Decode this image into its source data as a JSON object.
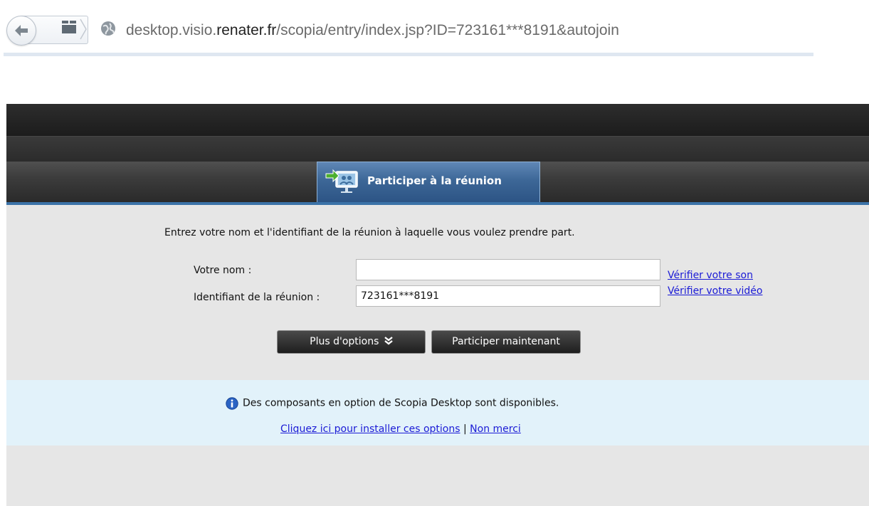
{
  "browser": {
    "url_prefix": "desktop.visio.",
    "url_host": "renater.fr",
    "url_path": "/scopia/entry/index.jsp?ID=723161***8191&autojoin",
    "back_icon": "back-arrow-icon",
    "accent": "#dfe7f1"
  },
  "app": {
    "active_tab_label": "Participer à la réunion",
    "tab_icon": "join-meeting-icon",
    "accent": "#3b73a8"
  },
  "form": {
    "instruction": "Entrez votre nom et l'identifiant de la réunion à laquelle vous voulez prendre part.",
    "name_label": "Votre nom :",
    "name_value": "",
    "id_label": "Identifiant de la réunion :",
    "id_value": "723161***8191",
    "check_sound_link": "Vérifier votre son",
    "check_video_link": "Vérifier votre vidéo",
    "more_options_button": "Plus d'options",
    "join_now_button": "Participer maintenant"
  },
  "info": {
    "icon": "info-icon",
    "message": "Des composants en option de Scopia Desktop sont disponibles.",
    "install_link": "Cliquez ici pour installer ces options",
    "separator": "|",
    "decline_link": "Non merci",
    "background": "#e2f2fa"
  }
}
